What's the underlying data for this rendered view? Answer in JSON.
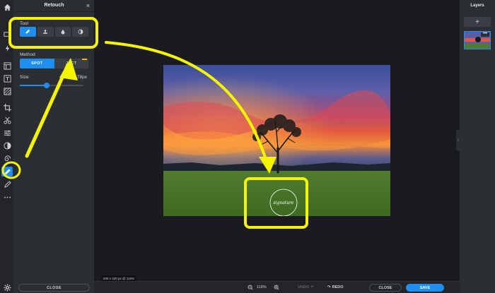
{
  "panel": {
    "title": "Retouch",
    "close_icon": "×",
    "tool_label": "Tool",
    "tools": [
      {
        "name": "spot-heal-icon",
        "active": true
      },
      {
        "name": "clone-stamp-icon",
        "active": false
      },
      {
        "name": "blur-drop-icon",
        "active": false
      },
      {
        "name": "dodge-burn-icon",
        "active": false
      }
    ],
    "method_label": "Method",
    "methods": [
      "SPOT",
      "OBJECT"
    ],
    "method_visible": [
      "SPOT",
      "JECT"
    ],
    "size_label": "Size",
    "size_value": "78px",
    "size_fraction": 0.42,
    "close_label": "CLOSE"
  },
  "canvas": {
    "dimensions_text": "630 x 420 px @ 118%"
  },
  "bottom": {
    "zoom": "118%",
    "undo": "UNDO",
    "redo": "REDO",
    "close": "CLOSE",
    "save": "SAVE"
  },
  "layers": {
    "title": "Layers",
    "add": "+",
    "menu": "•••"
  },
  "colors": {
    "accent": "#1e8ff0",
    "highlight": "#f5f500"
  }
}
